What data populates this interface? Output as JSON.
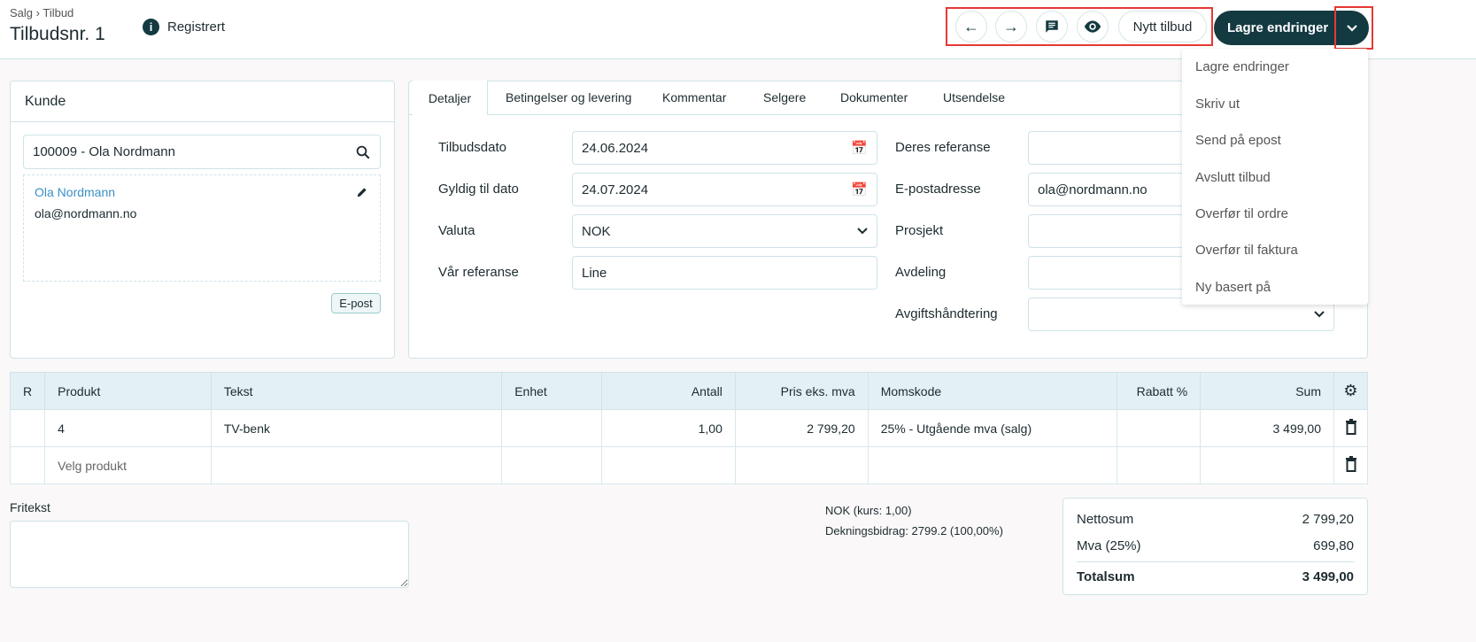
{
  "header": {
    "breadcrumb": [
      "Salg",
      "Tilbud"
    ],
    "title": "Tilbudsnr. 1",
    "status": "Registrert"
  },
  "toolbar": {
    "new_label": "Nytt tilbud",
    "save_label": "Lagre endringer"
  },
  "menu": [
    "Lagre endringer",
    "Skriv ut",
    "Send på epost",
    "Avslutt tilbud",
    "Overfør til ordre",
    "Overfør til faktura",
    "Ny basert på"
  ],
  "customer": {
    "heading": "Kunde",
    "search_value": "100009 - Ola Nordmann",
    "name": "Ola Nordmann",
    "email": "ola@nordmann.no",
    "email_button": "E-post"
  },
  "tabs": [
    "Detaljer",
    "Betingelser og levering",
    "Kommentar",
    "Selgere",
    "Dokumenter",
    "Utsendelse"
  ],
  "details": {
    "left": [
      {
        "label": "Tilbudsdato",
        "value": "24.06.2024"
      },
      {
        "label": "Gyldig til dato",
        "value": "24.07.2024"
      },
      {
        "label": "Valuta",
        "value": "NOK"
      },
      {
        "label": "Vår referanse",
        "value": "Line"
      }
    ],
    "right": [
      {
        "label": "Deres referanse",
        "value": ""
      },
      {
        "label": "E-postadresse",
        "value": "ola@nordmann.no"
      },
      {
        "label": "Prosjekt",
        "value": ""
      },
      {
        "label": "Avdeling",
        "value": ""
      },
      {
        "label": "Avgiftshåndtering",
        "value": ""
      }
    ]
  },
  "table": {
    "headers": [
      "R",
      "Produkt",
      "Tekst",
      "Enhet",
      "Antall",
      "Pris eks. mva",
      "Momskode",
      "Rabatt %",
      "Sum"
    ],
    "rows": [
      [
        "",
        "4",
        "TV-benk",
        "",
        "1,00",
        "2 799,20",
        "25% - Utgående mva (salg)",
        "",
        "3 499,00"
      ]
    ],
    "new_row_placeholder": "Velg produkt"
  },
  "footer": {
    "fritekst_label": "Fritekst",
    "currency_info": "NOK (kurs: 1,00)",
    "margin_info": "Dekningsbidrag: 2799.2 (100,00%)",
    "totals": [
      {
        "label": "Nettosum",
        "value": "2 799,20"
      },
      {
        "label": "Mva (25%)",
        "value": "699,80"
      },
      {
        "label": "Totalsum",
        "value": "3 499,00"
      }
    ]
  }
}
